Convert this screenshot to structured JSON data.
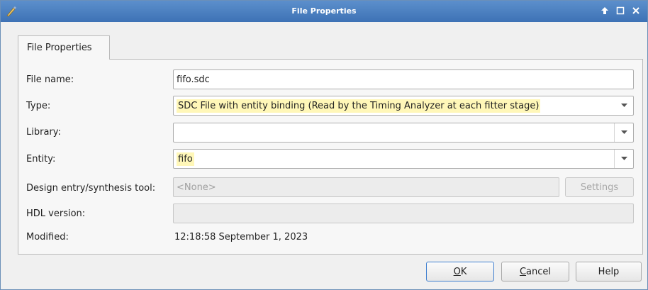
{
  "window": {
    "title": "File Properties"
  },
  "tabs": [
    {
      "label": "File Properties"
    }
  ],
  "form": {
    "file_name": {
      "label": "File name:",
      "value": "fifo.sdc"
    },
    "type": {
      "label": "Type:",
      "value": "SDC File with entity binding (Read by the Timing Analyzer at each fitter stage)"
    },
    "library": {
      "label": "Library:",
      "value": ""
    },
    "entity": {
      "label": "Entity:",
      "value": "fifo"
    },
    "tool": {
      "label": "Design entry/synthesis tool:",
      "value": "<None>",
      "settings_label": "Settings"
    },
    "hdl": {
      "label": "HDL version:",
      "value": ""
    },
    "modified": {
      "label": "Modified:",
      "value": "12:18:58 September 1, 2023"
    }
  },
  "buttons": {
    "ok": {
      "accel": "O",
      "rest": "K"
    },
    "cancel": {
      "accel": "C",
      "rest": "ancel"
    },
    "help": "Help"
  },
  "colors": {
    "titlebar": "#4a7fc0",
    "highlight": "#fff7b8",
    "default_border": "#3f7fd0"
  }
}
